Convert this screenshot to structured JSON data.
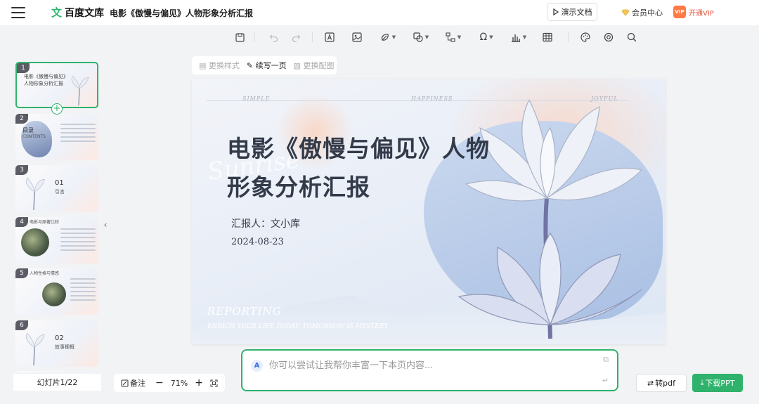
{
  "app": {
    "logo_mark": "文",
    "logo_text": "百度文库",
    "doc_title": "电影《傲慢与偏见》人物形象分析汇报"
  },
  "header": {
    "present_label": "演示文档",
    "member_label": "会员中心",
    "vip_label": "开通VIP",
    "vip_badge": "VIP"
  },
  "toolbar": {
    "items": [
      "save-icon",
      "undo-icon",
      "redo-icon",
      "textbox-icon",
      "image-icon",
      "shape-icon",
      "insert-shape-icon",
      "flowchart-icon",
      "symbol-icon",
      "chart-icon",
      "table-icon",
      "theme-icon",
      "animation-icon",
      "search-icon"
    ]
  },
  "subbar": {
    "change_style": "更换样式",
    "continue_write": "续写一页",
    "change_image": "更换配图"
  },
  "thumbnails": [
    {
      "num": "1",
      "title": "电影《傲慢与偏见》人物形象分析汇报"
    },
    {
      "num": "2",
      "title": "目录",
      "subtitle": "CONTENTS"
    },
    {
      "num": "3",
      "big": "01",
      "small": "引言"
    },
    {
      "num": "4",
      "title": "电影与原著比较"
    },
    {
      "num": "5",
      "title": "人物性格与情感"
    },
    {
      "num": "6",
      "big": "02",
      "small": "故事梗概"
    }
  ],
  "slide_count": "幻灯片1/22",
  "slide": {
    "words": [
      "SIMPLE",
      "HAPPINESS",
      "JOYFUL"
    ],
    "title": "电影《傲慢与偏见》人物形象分析汇报",
    "script_deco": "Sunrise",
    "reporter": "汇报人：文小库",
    "date": "2024-08-23",
    "reporting": "REPORTING",
    "enrich": "ENRICH YOUR LIFE TODAY, TOMORROW IS MYSTERY"
  },
  "bottom": {
    "notes_label": "备注",
    "zoom": "71%"
  },
  "prompt": {
    "placeholder": "你可以尝试让我帮你丰富一下本页内容..."
  },
  "actions": {
    "to_pdf": "转pdf",
    "download_ppt": "下载PPT"
  },
  "colors": {
    "accent": "#2fb36c",
    "vip": "#e4573d"
  }
}
